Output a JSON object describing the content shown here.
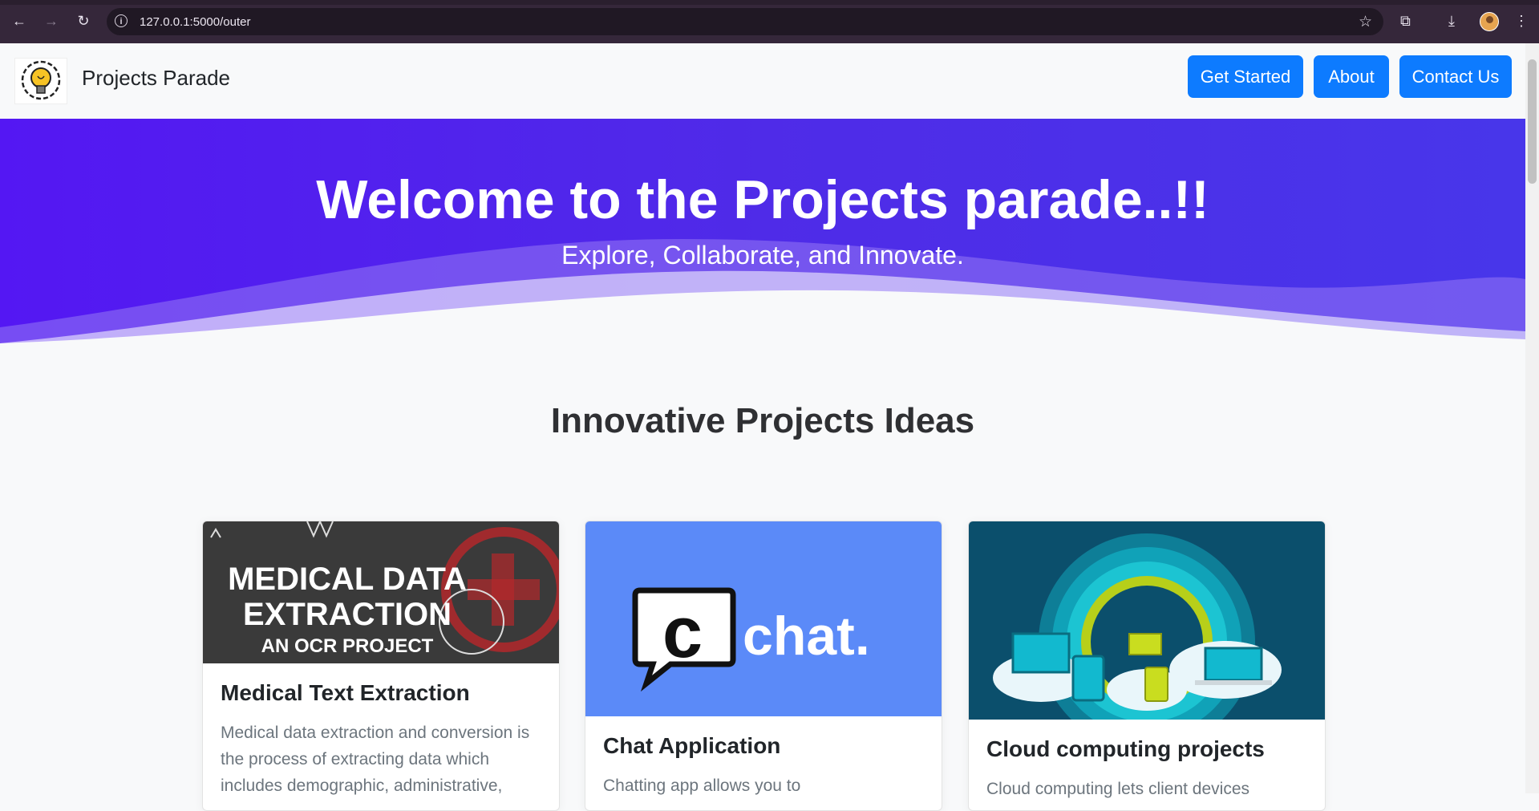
{
  "browser": {
    "url": "127.0.0.1:5000/outer",
    "back_icon": "←",
    "forward_icon": "→",
    "reload_icon": "↻",
    "star_icon": "☆",
    "extensions_icon": "⧉",
    "download_icon": "⤓",
    "menu_icon": "⋮",
    "info_icon": "i"
  },
  "navbar": {
    "brand": "Projects Parade",
    "links": [
      "Get Started",
      "About",
      "Contact Us"
    ],
    "button_color": "#0d7bff"
  },
  "hero": {
    "title": "Welcome to the Projects parade..!!",
    "subtitle": "Explore, Collaborate, and Innovate."
  },
  "section": {
    "title": "Innovative Projects Ideas"
  },
  "cards": [
    {
      "image_line1": "MEDICAL DATA",
      "image_line2": "EXTRACTION",
      "image_line3": "AN OCR PROJECT",
      "title": "Medical Text Extraction",
      "description": "Medical data extraction and conversion is the process of extracting data which includes demographic, administrative,"
    },
    {
      "image_text": "chat.",
      "image_glyph": "c",
      "title": "Chat Application",
      "description": "Chatting app allows you to"
    },
    {
      "title": "Cloud computing projects",
      "description": "Cloud computing lets client devices"
    }
  ]
}
